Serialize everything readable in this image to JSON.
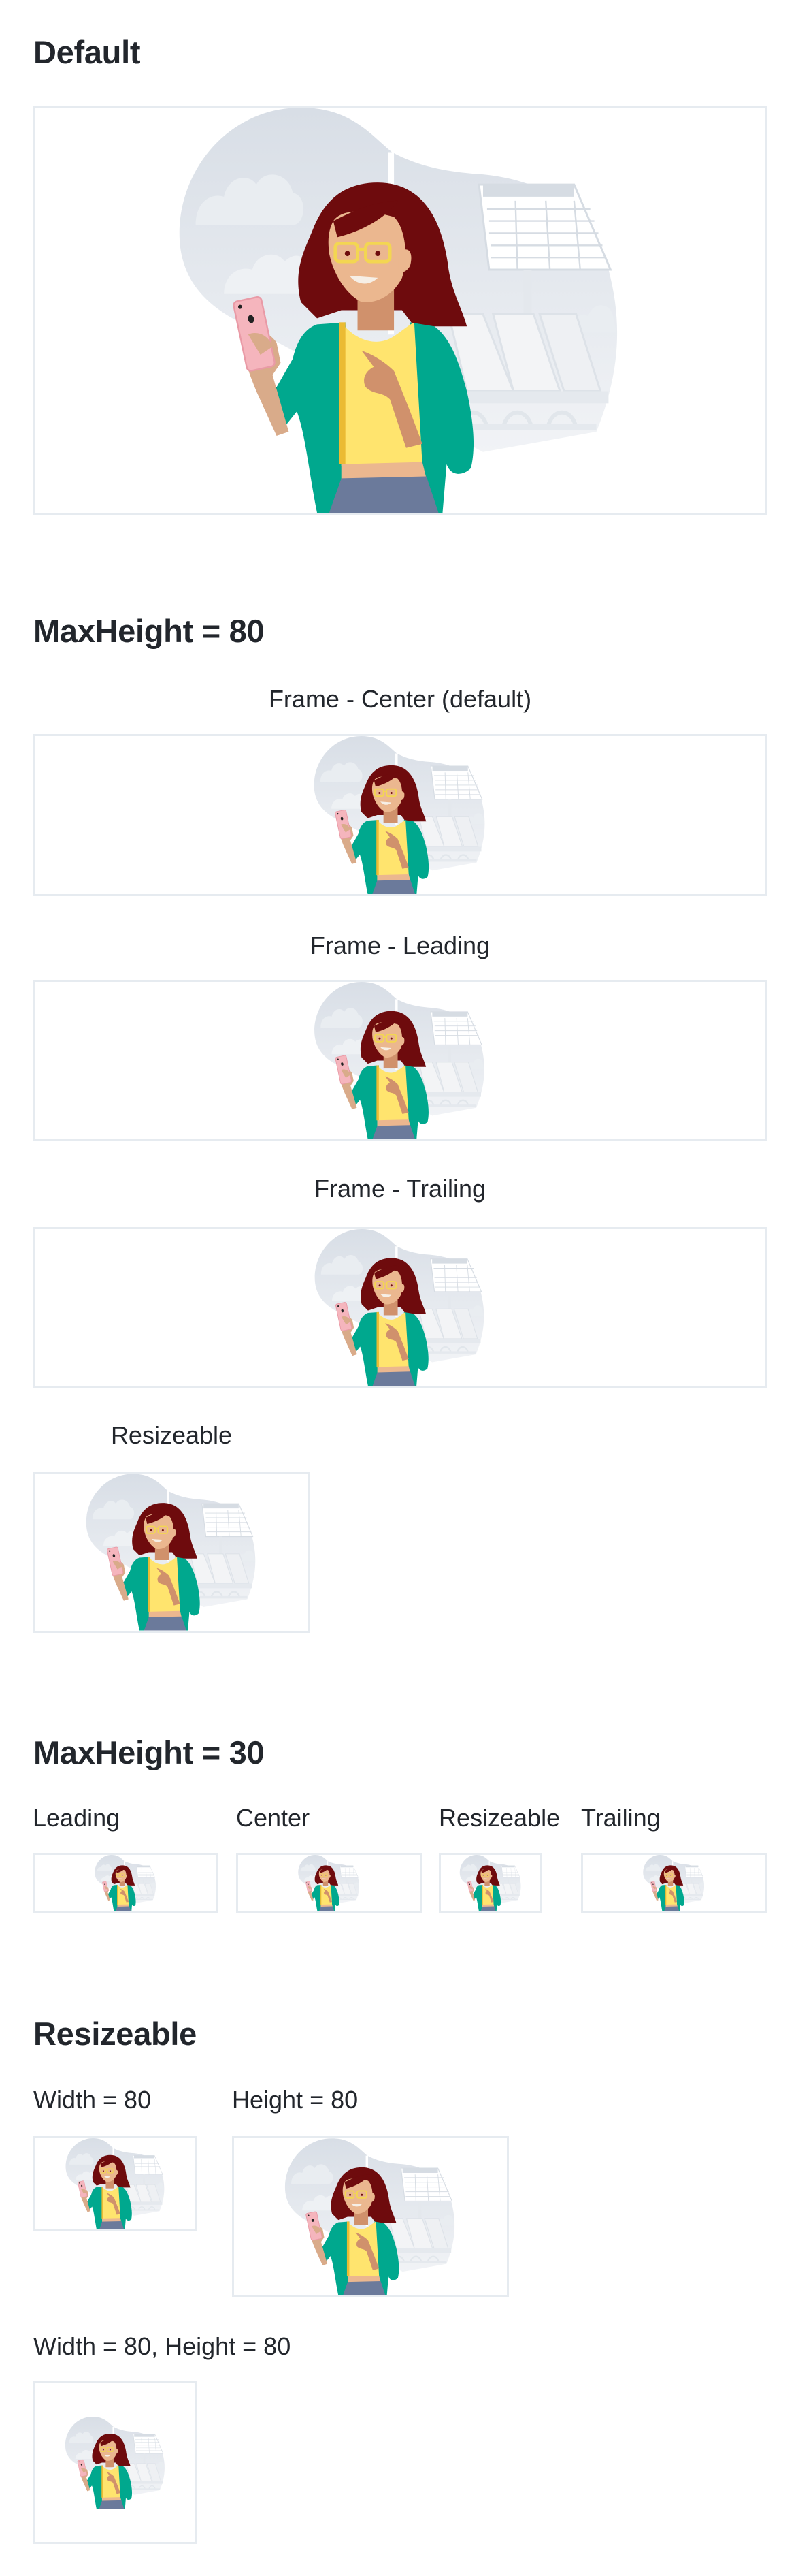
{
  "sections": {
    "default": {
      "title": "Default"
    },
    "max_height_80": {
      "title": "MaxHeight = 80",
      "frame_center_label": "Frame - Center (default)",
      "frame_leading_label": "Frame - Leading",
      "frame_trailing_label": "Frame - Trailing",
      "resizeable_label": "Resizeable"
    },
    "max_height_30": {
      "title": "MaxHeight = 30",
      "labels": [
        "Leading",
        "Center",
        "Resizeable",
        "Trailing"
      ]
    },
    "resizeable": {
      "title": "Resizeable",
      "width_label": "Width = 80",
      "height_label": "Height = 80",
      "width_height_label": "Width = 80, Height = 80"
    }
  },
  "illustration": {
    "name": "woman-with-phone-at-airport",
    "colors": {
      "blob": "#dde2e9",
      "hair": "#6e0b0d",
      "skin": "#ebb78f",
      "cardigan": "#00a88e",
      "shirt": "#ffe46e",
      "skirt": "#6b7a9b",
      "phone": "#f5b5bd",
      "glasses": "#f3d652",
      "border": "#e6ebf0"
    }
  }
}
